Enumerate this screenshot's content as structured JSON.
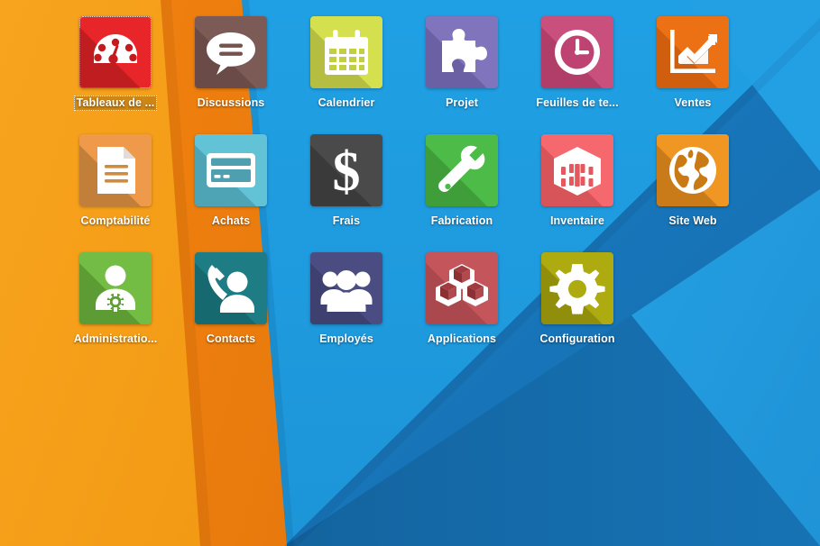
{
  "desktop": {
    "wallpaper": {
      "name": "material-angular-wallpaper",
      "colors": {
        "orange_light": "#f59c18",
        "orange_mid": "#f5901a",
        "orange_dark": "#ef7a11",
        "blue_bright": "#1e9ce0",
        "blue_light": "#229ee2",
        "blue_mid": "#1779c0",
        "blue_dark": "#1368a8",
        "blue_deep": "#156fae"
      }
    },
    "selected_icon": "Tableaux de ...",
    "icons": [
      {
        "label": "Tableaux de ...",
        "icon": "dashboard-gauge-icon",
        "tile_color": "#e8262a",
        "shadow_color": "#9c1518",
        "glyph_color": "#ffffff",
        "selected": true,
        "col": 0,
        "row": 0
      },
      {
        "label": "Discussions",
        "icon": "speech-bubble-icon",
        "tile_color": "#7c5a56",
        "shadow_color": "#5c403d",
        "glyph_color": "#ffffff",
        "selected": false,
        "col": 1,
        "row": 0
      },
      {
        "label": "Calendrier",
        "icon": "calendar-icon",
        "tile_color": "#d4e04e",
        "shadow_color": "#9aa336",
        "glyph_color": "#ffffff",
        "selected": false,
        "col": 2,
        "row": 0
      },
      {
        "label": "Projet",
        "icon": "puzzle-piece-icon",
        "tile_color": "#8074bd",
        "shadow_color": "#5b5190",
        "glyph_color": "#ffffff",
        "selected": false,
        "col": 3,
        "row": 0
      },
      {
        "label": "Feuilles de te...",
        "icon": "clock-icon",
        "tile_color": "#c94f7c",
        "shadow_color": "#9b3159",
        "glyph_color": "#ffffff",
        "selected": false,
        "col": 4,
        "row": 0
      },
      {
        "label": "Ventes",
        "icon": "sales-chart-arrow-icon",
        "tile_color": "#ec7014",
        "shadow_color": "#b8520a",
        "glyph_color": "#ffffff",
        "selected": false,
        "col": 5,
        "row": 0
      },
      {
        "label": "Comptabilité",
        "icon": "document-icon",
        "tile_color": "#ef9a4a",
        "shadow_color": "#9b6a2e",
        "glyph_color": "#ffffff",
        "selected": false,
        "col": 0,
        "row": 1
      },
      {
        "label": "Achats",
        "icon": "credit-card-icon",
        "tile_color": "#63c3d6",
        "shadow_color": "#3e8a9b",
        "glyph_color": "#ffffff",
        "selected": false,
        "col": 1,
        "row": 1
      },
      {
        "label": "Frais",
        "icon": "dollar-sign-icon",
        "tile_color": "#4a4a4a",
        "shadow_color": "#2e2e2e",
        "glyph_color": "#ffffff",
        "selected": false,
        "col": 2,
        "row": 1
      },
      {
        "label": "Fabrication",
        "icon": "wrench-icon",
        "tile_color": "#4cbb47",
        "shadow_color": "#34862f",
        "glyph_color": "#ffffff",
        "selected": false,
        "col": 3,
        "row": 1
      },
      {
        "label": "Inventaire",
        "icon": "warehouse-icon",
        "tile_color": "#f4686e",
        "shadow_color": "#c04449",
        "glyph_color": "#ffffff",
        "selected": false,
        "col": 4,
        "row": 1
      },
      {
        "label": "Site Web",
        "icon": "globe-icon",
        "tile_color": "#ef9722",
        "shadow_color": "#a96512",
        "glyph_color": "#ffffff",
        "selected": false,
        "col": 5,
        "row": 1
      },
      {
        "label": "Administratio...",
        "icon": "user-settings-icon",
        "tile_color": "#74bd44",
        "shadow_color": "#4b8129",
        "glyph_color": "#ffffff",
        "selected": false,
        "col": 0,
        "row": 2
      },
      {
        "label": "Contacts",
        "icon": "phone-contact-icon",
        "tile_color": "#1d7c84",
        "shadow_color": "#125a60",
        "glyph_color": "#ffffff",
        "selected": false,
        "col": 1,
        "row": 2
      },
      {
        "label": "Employés",
        "icon": "people-group-icon",
        "tile_color": "#4b4d82",
        "shadow_color": "#343662",
        "glyph_color": "#ffffff",
        "selected": false,
        "col": 2,
        "row": 2
      },
      {
        "label": "Applications",
        "icon": "boxes-stack-icon",
        "tile_color": "#c4565b",
        "shadow_color": "#953e42",
        "glyph_color": "#ffffff",
        "selected": false,
        "col": 3,
        "row": 2
      },
      {
        "label": "Configuration",
        "icon": "gear-icon",
        "tile_color": "#adab0f",
        "shadow_color": "#78770a",
        "glyph_color": "#ffffff",
        "selected": false,
        "col": 4,
        "row": 2
      }
    ]
  }
}
